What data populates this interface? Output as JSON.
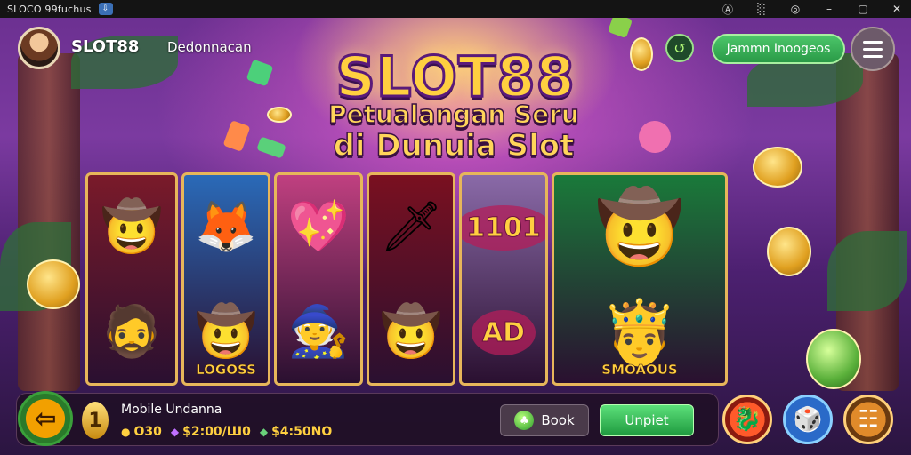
{
  "os_bar": {
    "title": "SLOCO 99fuchus",
    "controls": [
      "Ⓐ",
      "░",
      "◎",
      "–",
      "▢",
      "✕"
    ]
  },
  "header": {
    "brand": "SLOT88",
    "subnav": "Dedonnacan",
    "pill_button": "Jammn Inoogeos",
    "circle_icon": "↺"
  },
  "hero": {
    "logo": "SLOT88",
    "tagline_line1": "Petualangan Seru",
    "tagline_line2": "di Dunuia Slot"
  },
  "reels": [
    {
      "bg": "#7a1a2a",
      "top": {
        "icon": "pirate-icon",
        "glyph": "🤠"
      },
      "bottom": {
        "icon": "pirate-icon",
        "glyph": "🧔"
      }
    },
    {
      "bg": "#2a6ab8",
      "top": {
        "icon": "creature-icon",
        "glyph": "🦊"
      },
      "bottom": {
        "icon": "explorer-icon",
        "glyph": "🤠",
        "label": "LOGOSS"
      }
    },
    {
      "bg": "#c04080",
      "top": {
        "icon": "heart-icon",
        "glyph": "💖"
      },
      "bottom": {
        "icon": "viking-icon",
        "glyph": "🧙"
      }
    },
    {
      "bg": "#7a1020",
      "top": {
        "icon": "sword-icon",
        "glyph": "🗡"
      },
      "bottom": {
        "icon": "pirate-captain-icon",
        "glyph": "🤠"
      }
    },
    {
      "bg": "#8a6aa8",
      "top": {
        "badge": "1101"
      },
      "bottom": {
        "badge": "AD"
      }
    },
    {
      "bg": "#1a7a3a",
      "top": {
        "icon": "cowboy-icon",
        "glyph": "🤠"
      },
      "bottom": {
        "icon": "king-icon",
        "glyph": "🤴",
        "label": "SMOAOUS"
      }
    }
  ],
  "bottom_bar": {
    "back_icon": "⇦",
    "level": "1",
    "mode": "Mobile Undanna",
    "stats": [
      {
        "icon": "●",
        "value": "O30"
      },
      {
        "icon": "◆",
        "value": "$2:00/Ш0"
      },
      {
        "icon": "◆",
        "value": "$4:50NO"
      }
    ],
    "book_label": "Book",
    "play_label": "Unpiet"
  },
  "right_buttons": [
    {
      "name": "dragon-icon",
      "glyph": "🐉"
    },
    {
      "name": "dice-icon",
      "glyph": "🎲"
    },
    {
      "name": "settings-icon",
      "glyph": "☷"
    }
  ],
  "colors": {
    "accent_gold": "#ffd040",
    "accent_green": "#2a9a47",
    "accent_magenta": "#ff6fd0"
  }
}
